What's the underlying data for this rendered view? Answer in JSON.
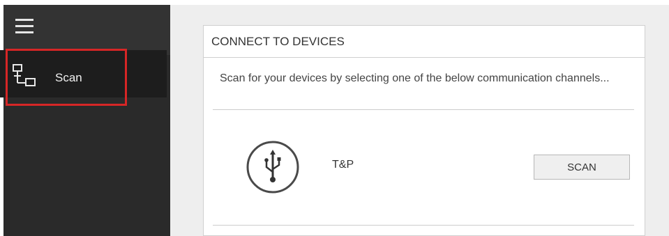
{
  "sidebar": {
    "menu_icon": "hamburger-menu-icon",
    "items": [
      {
        "label": "Scan",
        "icon": "network-devices-icon",
        "highlight_color": "#d62626"
      }
    ]
  },
  "panel": {
    "title": "CONNECT TO DEVICES",
    "description": "Scan for your devices by selecting one of the below communication channels...",
    "channels": [
      {
        "name": "T&P",
        "icon": "usb-icon",
        "button_label": "SCAN"
      }
    ]
  },
  "colors": {
    "sidebar_bg": "#2a2a2a",
    "sidebar_selected_bg": "#1d1d1d",
    "main_bg": "#eeeeee",
    "highlight": "#d62626"
  }
}
